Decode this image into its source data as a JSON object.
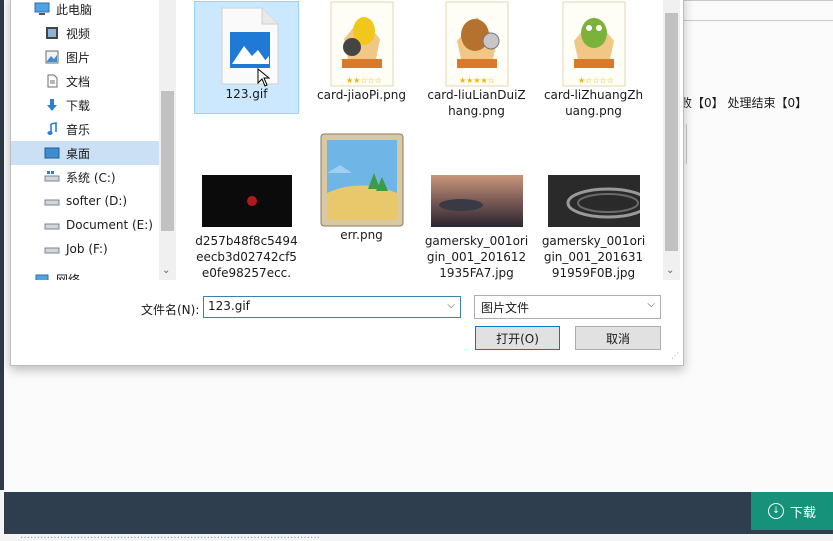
{
  "background": {
    "status_text": "败【0】 处理结束【0】",
    "footer_text": "………………………………………………………………………………",
    "download_label": "下载",
    "download_icon": "download-arrow-icon"
  },
  "nav": {
    "items": [
      {
        "label": "此电脑",
        "icon": "pc-icon"
      },
      {
        "label": "视频",
        "icon": "video-icon"
      },
      {
        "label": "图片",
        "icon": "pictures-icon"
      },
      {
        "label": "文档",
        "icon": "documents-icon"
      },
      {
        "label": "下载",
        "icon": "downloads-icon"
      },
      {
        "label": "音乐",
        "icon": "music-icon"
      },
      {
        "label": "桌面",
        "icon": "desktop-icon",
        "selected": true
      },
      {
        "label": "系统 (C:)",
        "icon": "drive-icon"
      },
      {
        "label": "softer (D:)",
        "icon": "drive-icon"
      },
      {
        "label": "Document (E:)",
        "icon": "drive-icon"
      },
      {
        "label": "Job (F:)",
        "icon": "drive-icon"
      },
      {
        "label": "网络",
        "icon": "network-icon"
      }
    ]
  },
  "files": [
    {
      "name": "123.gif",
      "kind": "image-placeholder",
      "selected": true
    },
    {
      "name": "card-jiaoPi.png",
      "kind": "card-yellow"
    },
    {
      "name": "card-liuLianDuiZhang.png",
      "kind": "card-brown"
    },
    {
      "name": "card-liZhuangZhuang.png",
      "kind": "card-green"
    },
    {
      "name": "d257b48f8c5494eecb3d02742cf5e0fe98257ecc.",
      "kind": "dark-photo"
    },
    {
      "name": "err.png",
      "kind": "err-picture"
    },
    {
      "name": "gamersky_001origin_001_2016121935FA7.jpg",
      "kind": "photo-warm"
    },
    {
      "name": "gamersky_001origin_001_20163191959F0B.jpg",
      "kind": "photo-grey"
    }
  ],
  "form": {
    "filename_label": "文件名(N):",
    "filename_value": "123.gif",
    "filetype_value": "图片文件",
    "open_label": "打开(O)",
    "cancel_label": "取消"
  },
  "colors": {
    "selection": "#cce8ff",
    "accent": "#0078d7",
    "download_bg": "#16927b"
  }
}
